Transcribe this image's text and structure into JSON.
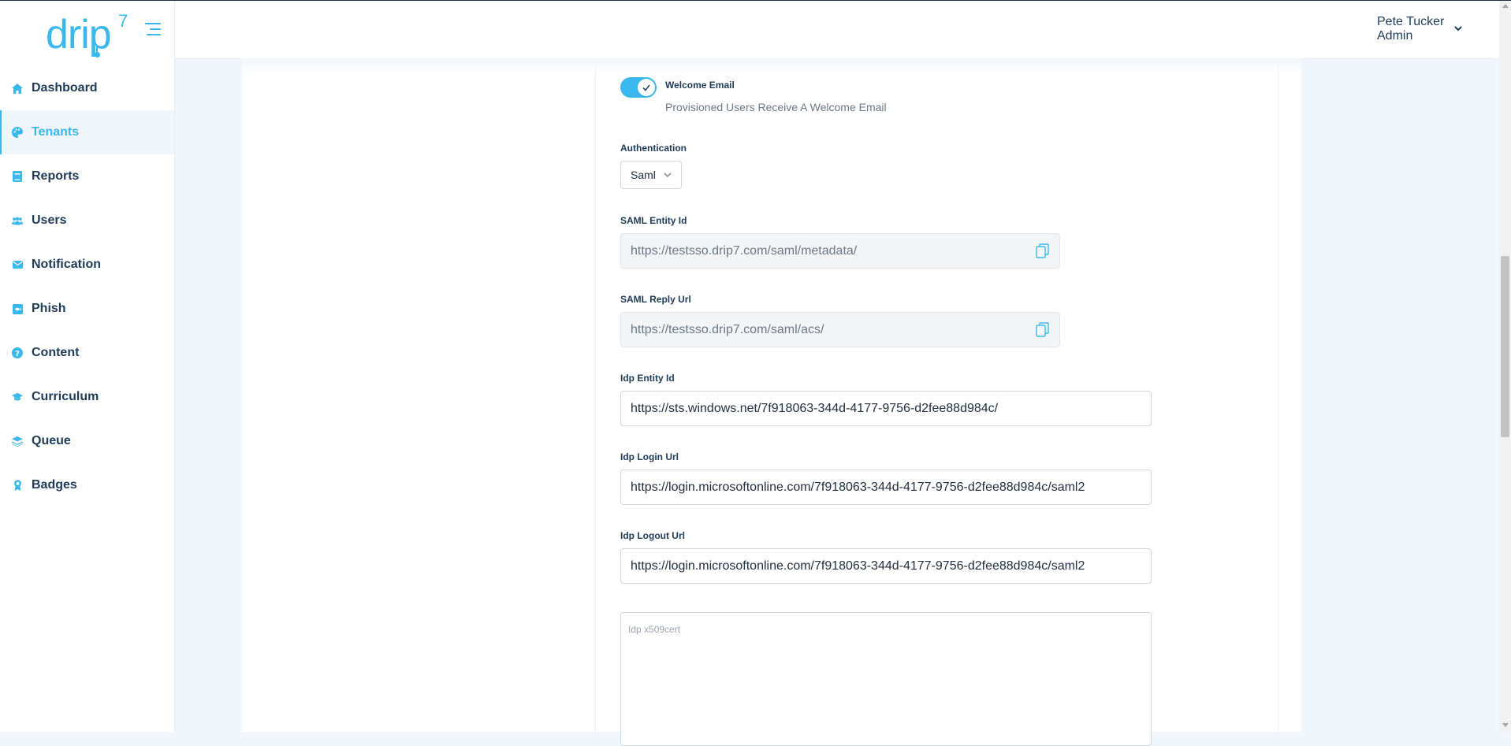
{
  "brand": {
    "logo_text": "drip",
    "logo_sup": "7",
    "color": "#3ab8eb"
  },
  "sidebar": {
    "items": [
      {
        "label": "Dashboard",
        "icon": "home-icon",
        "active": false
      },
      {
        "label": "Tenants",
        "icon": "palette-icon",
        "active": true
      },
      {
        "label": "Reports",
        "icon": "book-icon",
        "active": false
      },
      {
        "label": "Users",
        "icon": "users-icon",
        "active": false
      },
      {
        "label": "Notification",
        "icon": "envelope-icon",
        "active": false
      },
      {
        "label": "Phish",
        "icon": "phish-icon",
        "active": false
      },
      {
        "label": "Content",
        "icon": "question-circle-icon",
        "active": false
      },
      {
        "label": "Curriculum",
        "icon": "graduation-cap-icon",
        "active": false
      },
      {
        "label": "Queue",
        "icon": "layers-icon",
        "active": false
      },
      {
        "label": "Badges",
        "icon": "award-icon",
        "active": false
      }
    ]
  },
  "header": {
    "user_name": "Pete Tucker",
    "user_role": "Admin"
  },
  "form": {
    "welcome_email": {
      "label": "Welcome Email",
      "description": "Provisioned Users Receive A Welcome Email",
      "enabled": true
    },
    "authentication": {
      "label": "Authentication",
      "value": "Saml"
    },
    "saml_entity_id": {
      "label": "SAML Entity Id",
      "value": "https://testsso.drip7.com/saml/metadata/"
    },
    "saml_reply_url": {
      "label": "SAML Reply Url",
      "value": "https://testsso.drip7.com/saml/acs/"
    },
    "idp_entity_id": {
      "label": "Idp Entity Id",
      "value": "https://sts.windows.net/7f918063-344d-4177-9756-d2fee88d984c/"
    },
    "idp_login_url": {
      "label": "Idp Login Url",
      "value": "https://login.microsoftonline.com/7f918063-344d-4177-9756-d2fee88d984c/saml2"
    },
    "idp_logout_url": {
      "label": "Idp Logout Url",
      "value": "https://login.microsoftonline.com/7f918063-344d-4177-9756-d2fee88d984c/saml2"
    },
    "idp_x509cert": {
      "placeholder": "Idp x509cert",
      "value": ""
    }
  }
}
